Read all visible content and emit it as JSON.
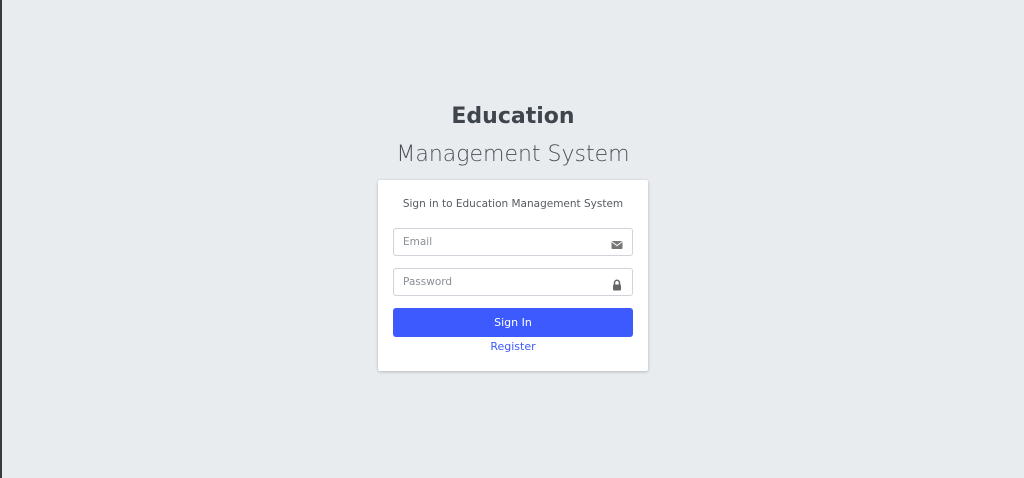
{
  "header": {
    "title_bold": "Education",
    "title_rest": " Management System"
  },
  "login": {
    "message": "Sign in to Education Management System",
    "email_placeholder": "Email",
    "email_value": "",
    "email_icon": "envelope-icon",
    "password_placeholder": "Password",
    "password_value": "",
    "password_icon": "lock-icon",
    "signin_label": "Sign In",
    "register_label": "Register"
  },
  "colors": {
    "background": "#e9ecef",
    "primary": "#3d5afe",
    "card": "#ffffff"
  }
}
